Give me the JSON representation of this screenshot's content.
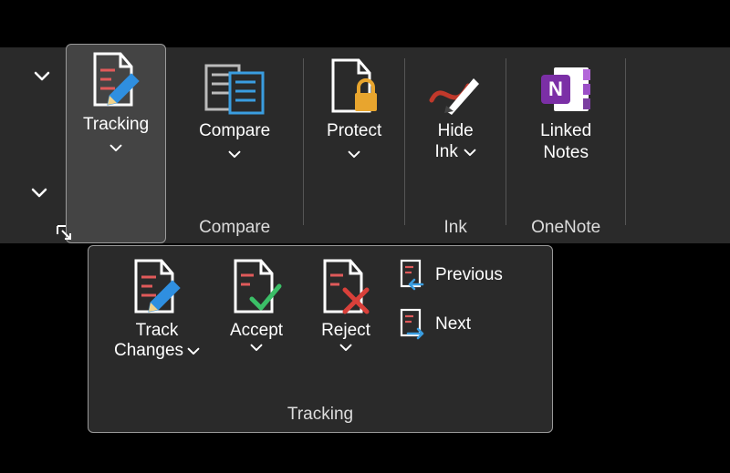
{
  "ribbon": {
    "tracking_label": "Tracking",
    "compare_label": "Compare",
    "protect_label": "Protect",
    "hide_ink_line1": "Hide",
    "hide_ink_line2": "Ink",
    "linked_notes_line1": "Linked",
    "linked_notes_line2": "Notes",
    "group_compare": "Compare",
    "group_ink": "Ink",
    "group_onenote": "OneNote"
  },
  "flyout": {
    "track_changes_line1": "Track",
    "track_changes_line2": "Changes",
    "accept_label": "Accept",
    "reject_label": "Reject",
    "previous_label": "Previous",
    "next_label": "Next",
    "group_label": "Tracking"
  }
}
